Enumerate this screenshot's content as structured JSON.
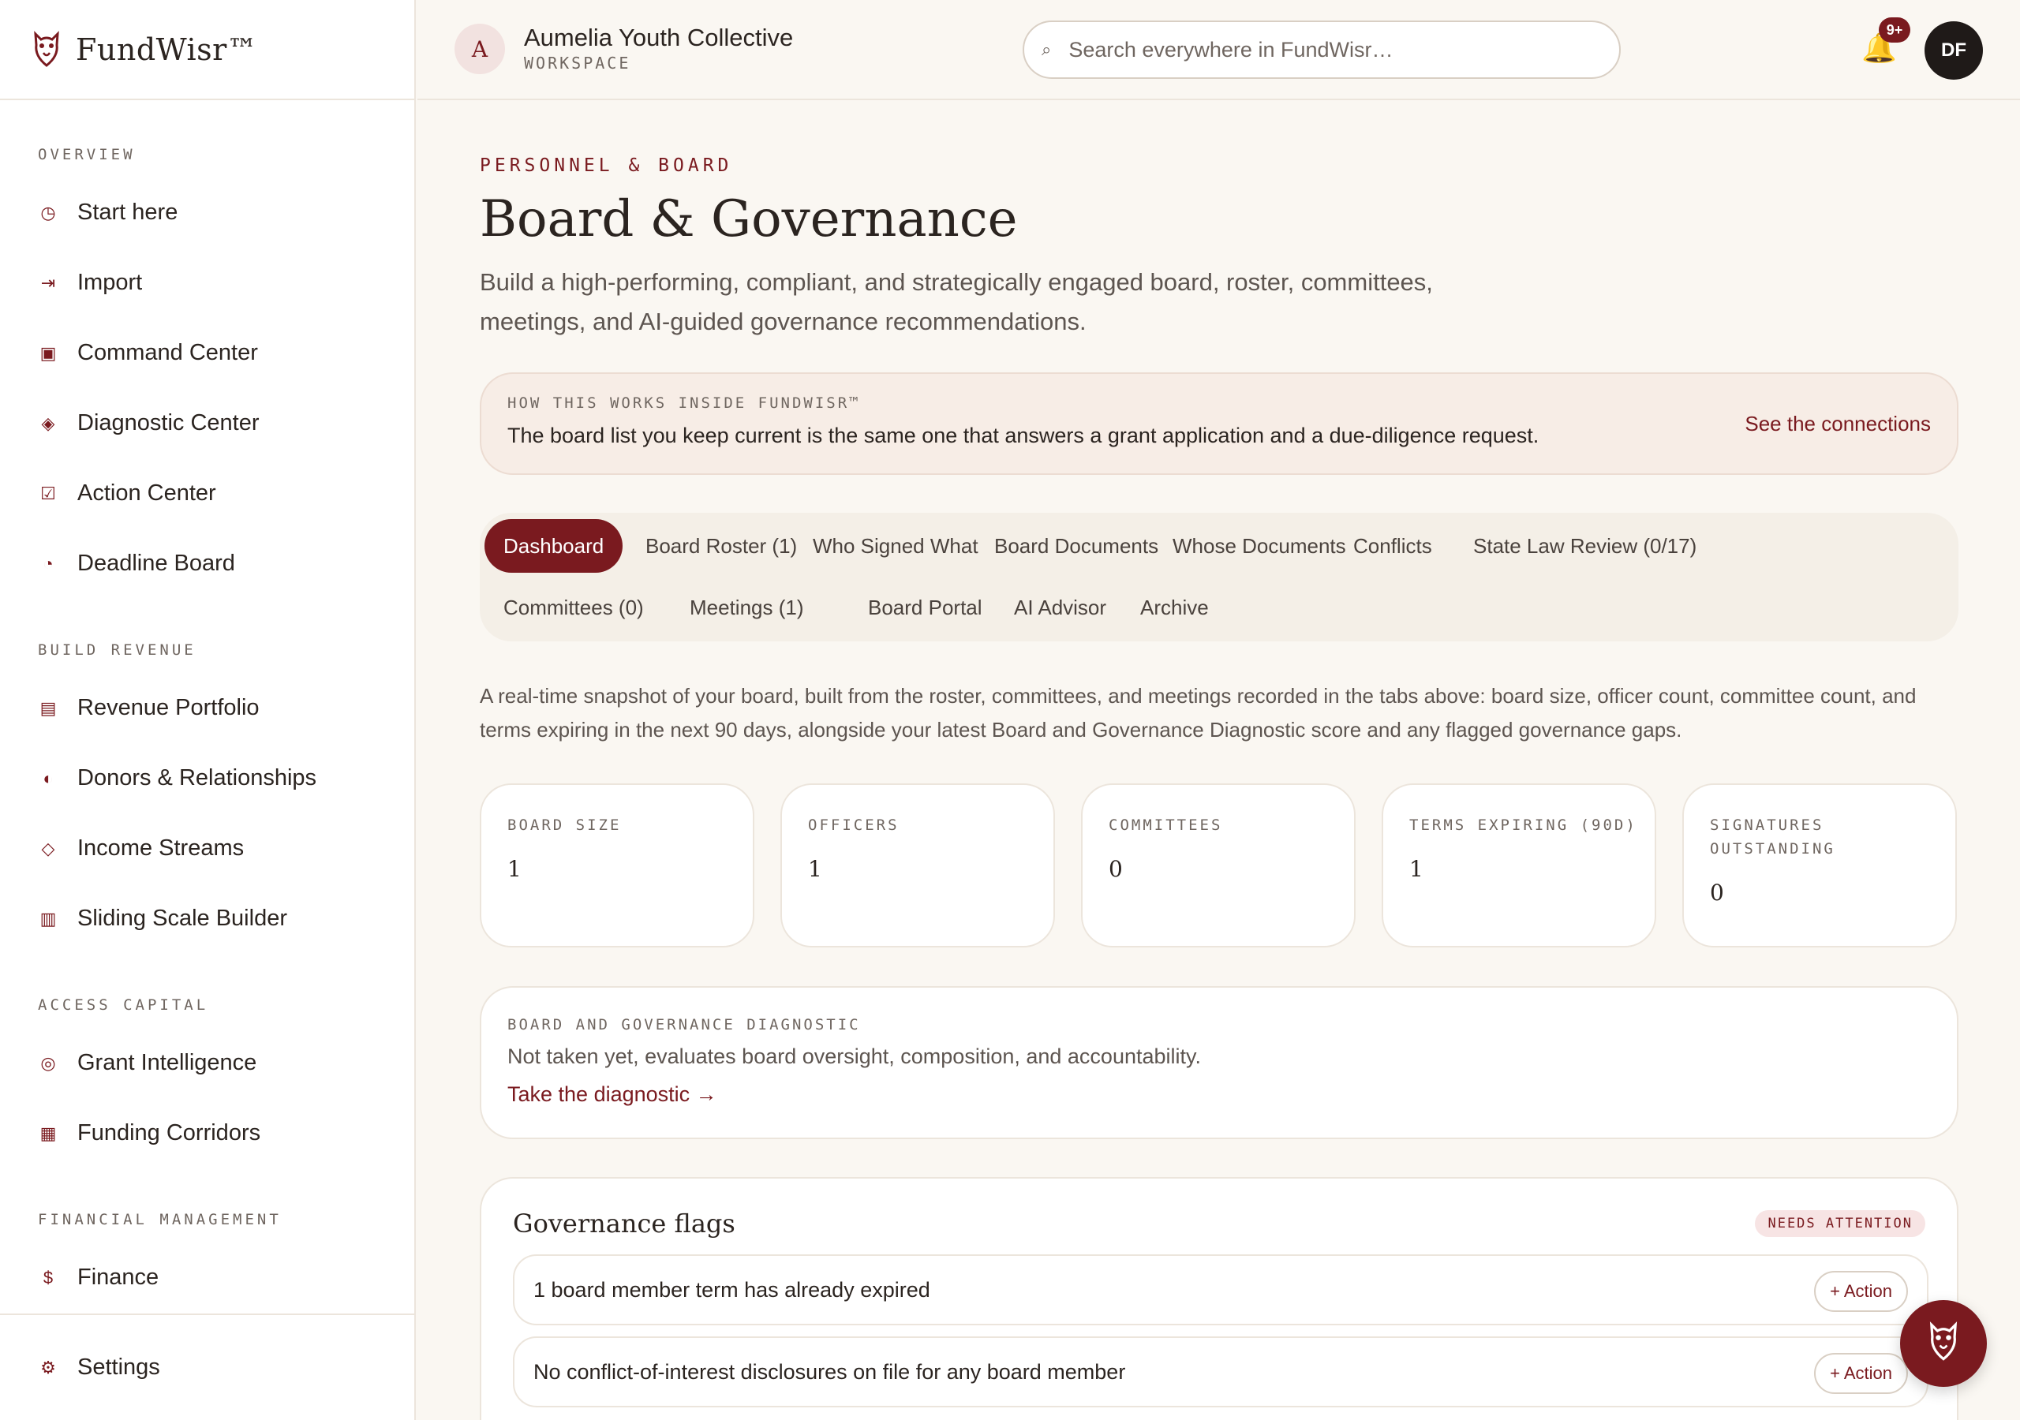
{
  "brand": {
    "name": "FundWisr™",
    "logo_icon": "owl-icon"
  },
  "colors": {
    "accent": "#7a1a1f",
    "background": "#faf7f2",
    "bell": "#e8a02a"
  },
  "sidebar": {
    "sections": [
      {
        "title": "OVERVIEW",
        "items": [
          {
            "label": "Start here",
            "icon": "clock-icon"
          },
          {
            "label": "Import",
            "icon": "import-arrow-icon"
          },
          {
            "label": "Command Center",
            "icon": "square-icon"
          },
          {
            "label": "Diagnostic Center",
            "icon": "diamond-icon"
          },
          {
            "label": "Action Center",
            "icon": "checkbox-icon"
          },
          {
            "label": "Deadline Board",
            "icon": "pie-icon"
          }
        ]
      },
      {
        "title": "BUILD REVENUE",
        "items": [
          {
            "label": "Revenue Portfolio",
            "icon": "list-icon"
          },
          {
            "label": "Donors & Relationships",
            "icon": "half-circle-icon"
          },
          {
            "label": "Income Streams",
            "icon": "diamond-outline-icon"
          },
          {
            "label": "Sliding Scale Builder",
            "icon": "columns-icon"
          }
        ]
      },
      {
        "title": "ACCESS CAPITAL",
        "items": [
          {
            "label": "Grant Intelligence",
            "icon": "target-icon"
          },
          {
            "label": "Funding Corridors",
            "icon": "grid-icon"
          }
        ]
      },
      {
        "title": "FINANCIAL MANAGEMENT",
        "items": [
          {
            "label": "Finance",
            "icon": "dollar-icon"
          }
        ]
      }
    ],
    "footer": {
      "label": "Settings",
      "icon": "gear-icon"
    }
  },
  "header": {
    "workspace_initial": "A",
    "workspace_name": "Aumelia Youth Collective",
    "workspace_sub": "WORKSPACE",
    "search_placeholder": "Search everywhere in FundWisr…",
    "notification_count": "9+",
    "user_initials": "DF"
  },
  "page": {
    "eyebrow": "PERSONNEL & BOARD",
    "title": "Board & Governance",
    "description": "Build a high-performing, compliant, and strategically engaged board, roster, committees, meetings, and AI-guided governance recommendations.",
    "how": {
      "label": "HOW THIS WORKS INSIDE FUNDWISR™",
      "text": "The board list you keep current is the same one that answers a grant application and a due-diligence request.",
      "link": "See the connections"
    },
    "tabs": [
      "Dashboard",
      "Board Roster (1)",
      "Who Signed What",
      "Board Documents",
      "Whose Documents",
      "Conflicts",
      "State Law Review (0/17)",
      "Committees (0)",
      "Meetings (1)",
      "Board Portal",
      "AI Advisor",
      "Archive"
    ],
    "active_tab": "Dashboard",
    "snapshot_text": "A real-time snapshot of your board, built from the roster, committees, and meetings recorded in the tabs above: board size, officer count, committee count, and terms expiring in the next 90 days, alongside your latest Board and Governance Diagnostic score and any flagged governance gaps.",
    "stats": [
      {
        "label": "BOARD SIZE",
        "value": "1"
      },
      {
        "label": "OFFICERS",
        "value": "1"
      },
      {
        "label": "COMMITTEES",
        "value": "0"
      },
      {
        "label": "TERMS EXPIRING (90D)",
        "value": "1"
      },
      {
        "label": "SIGNATURES OUTSTANDING",
        "value": "0"
      }
    ],
    "diagnostic": {
      "label": "BOARD AND GOVERNANCE DIAGNOSTIC",
      "text": "Not taken yet, evaluates board oversight, composition, and accountability.",
      "link": "Take the diagnostic →"
    },
    "flags": {
      "title": "Governance flags",
      "badge": "NEEDS ATTENTION",
      "items": [
        {
          "text": "1 board member term has already expired",
          "action": "+ Action"
        },
        {
          "text": "No conflict-of-interest disclosures on file for any board member",
          "action": "+ Action"
        }
      ]
    }
  }
}
